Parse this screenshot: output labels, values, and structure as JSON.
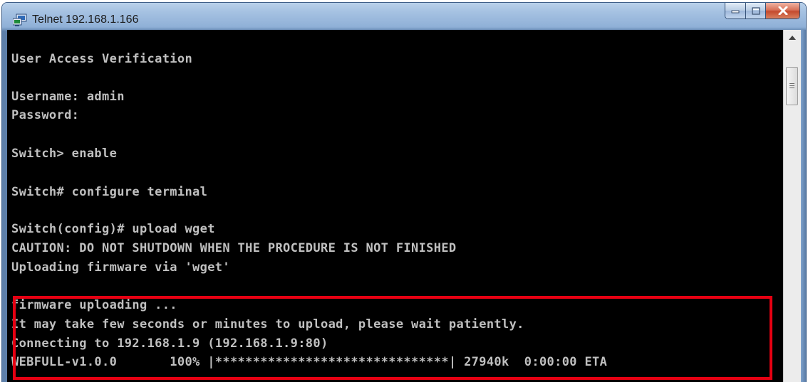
{
  "window": {
    "title": "Telnet 192.168.1.166",
    "icon": "telnet-terminal-icon"
  },
  "controls": {
    "minimize_icon": "minimize-icon",
    "maximize_icon": "maximize-icon",
    "close_icon": "close-icon"
  },
  "terminal": {
    "lines": [
      "User Access Verification",
      "",
      "Username: admin",
      "Password:",
      "",
      "Switch> enable",
      "",
      "Switch# configure terminal",
      "",
      "Switch(config)# upload wget",
      "CAUTION: DO NOT SHUTDOWN WHEN THE PROCEDURE IS NOT FINISHED",
      "Uploading firmware via 'wget'",
      "",
      "firmware uploading ...",
      "It may take few seconds or minutes to upload, please wait patiently.",
      "Connecting to 192.168.1.9 (192.168.1.9:80)",
      "WEBFULL-v1.0.0       100% |*******************************| 27940k  0:00:00 ETA"
    ]
  },
  "highlight_color": "#e60012",
  "colors": {
    "terminal_bg": "#000000",
    "terminal_fg": "#c0c0c0",
    "close_button": "#c44a2e"
  }
}
